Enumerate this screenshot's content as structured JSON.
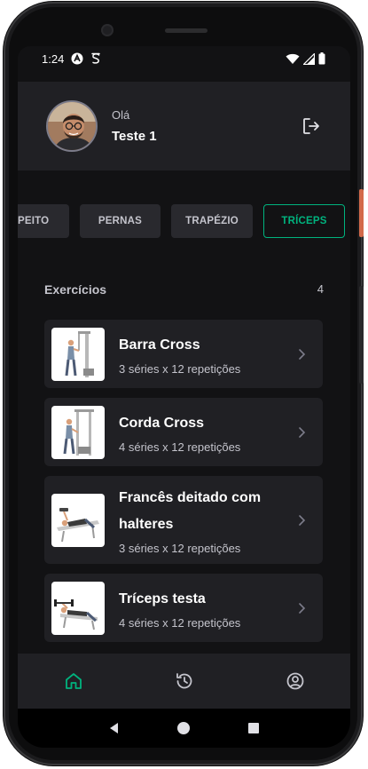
{
  "status": {
    "time": "1:24"
  },
  "profile": {
    "greeting": "Olá",
    "name": "Teste 1"
  },
  "groups": [
    {
      "label": "PEITO",
      "active": false
    },
    {
      "label": "PERNAS",
      "active": false
    },
    {
      "label": "TRAPÉZIO",
      "active": false
    },
    {
      "label": "TRÍCEPS",
      "active": true
    }
  ],
  "exercises": {
    "title": "Exercícios",
    "count": "4",
    "items": [
      {
        "name": "Barra Cross",
        "info": "3 séries x 12 repetições"
      },
      {
        "name": "Corda Cross",
        "info": "4 séries x 12 repetições"
      },
      {
        "name": "Francês deitado com halteres",
        "info": "3 séries x 12 repetições"
      },
      {
        "name": "Tríceps testa",
        "info": "4 séries x 12 repetições"
      }
    ]
  },
  "tabs": [
    {
      "icon": "home-icon",
      "active": true
    },
    {
      "icon": "history-icon",
      "active": false
    },
    {
      "icon": "profile-icon",
      "active": false
    }
  ],
  "colors": {
    "accent": "#00B37E",
    "background": "#121214",
    "card": "#202024",
    "text": "#FFFFFF",
    "muted": "#C4C4CC"
  }
}
